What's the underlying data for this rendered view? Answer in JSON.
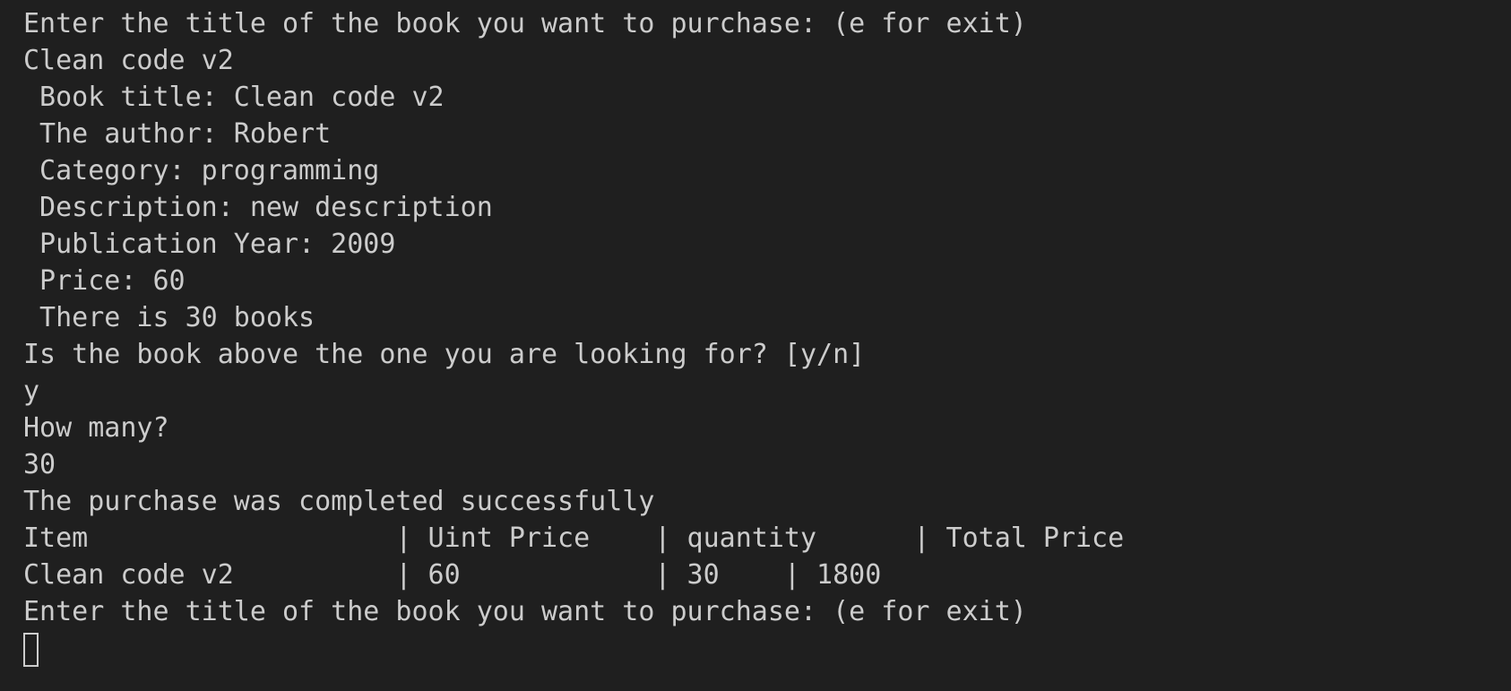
{
  "terminal": {
    "lines": [
      "Enter the title of the book you want to purchase: (e for exit)",
      "Clean code v2",
      " Book title: Clean code v2",
      " The author: Robert",
      " Category: programming",
      " Description: new description",
      " Publication Year: 2009",
      " Price: 60",
      " There is 30 books",
      "Is the book above the one you are looking for? [y/n]",
      "y",
      "How many?",
      "30",
      "The purchase was completed successfully",
      "Item                   | Uint Price    | quantity      | Total Price",
      "Clean code v2          | 60            | 30    | 1800",
      "Enter the title of the book you want to purchase: (e for exit)"
    ]
  }
}
